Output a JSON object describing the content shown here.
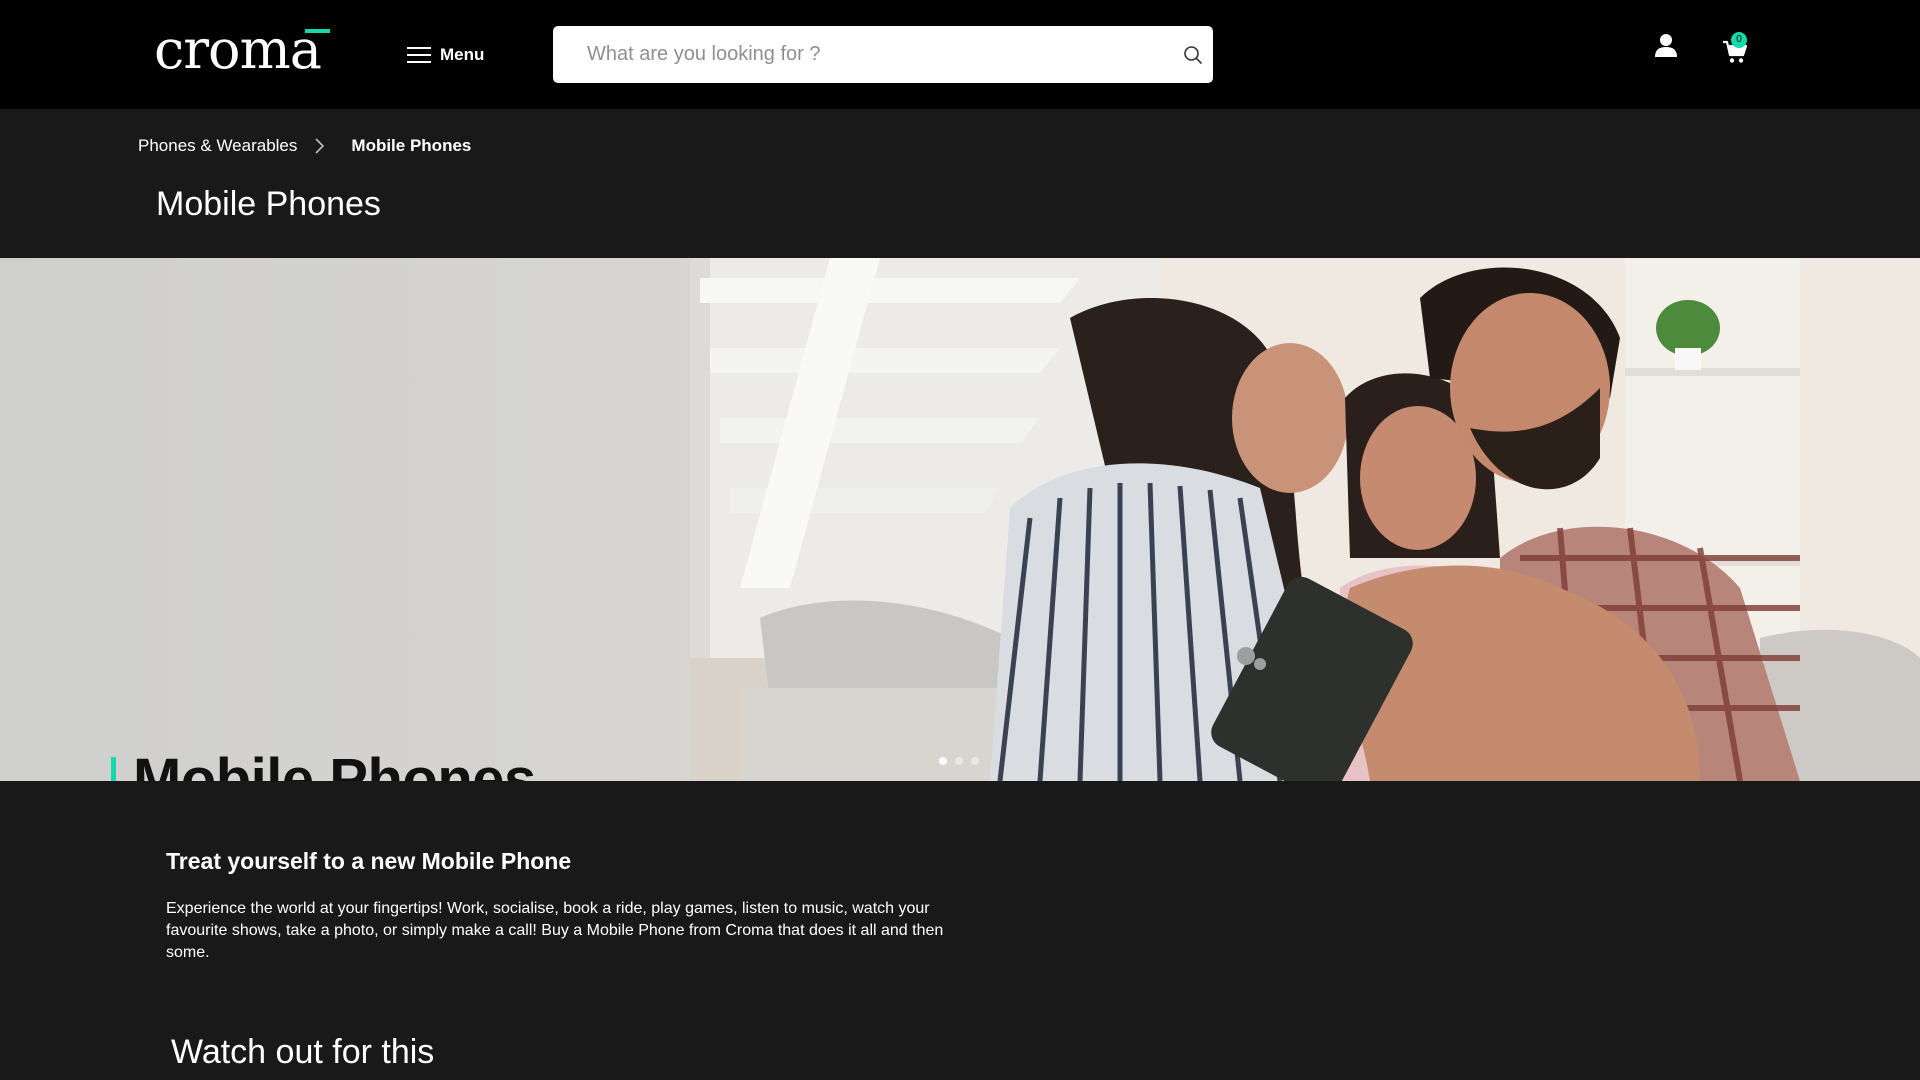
{
  "header": {
    "logo_text": "croma",
    "menu_label": "Menu",
    "search_placeholder": "What are you looking for ?",
    "cart_count": "0",
    "icons": [
      "menu-icon",
      "search-icon",
      "user-icon",
      "cart-icon"
    ]
  },
  "breadcrumb": {
    "items": [
      "Phones & Wearables"
    ],
    "current": "Mobile Phones"
  },
  "page_title": "Mobile Phones",
  "banner": {
    "heading": "Mobile Phones",
    "slides_total": 3,
    "active_slide": 1
  },
  "intro": {
    "heading": "Treat yourself to a new Mobile Phone",
    "text": "Experience the world at your fingertips! Work, socialise, book a ride, play games, listen to music, watch your favourite shows, take a photo, or simply make a call! Buy a Mobile Phone from Croma that does it all and then some."
  },
  "watch_heading": "Watch out for this",
  "colors": {
    "accent": "#12daa8",
    "header_bg": "#000000",
    "page_bg": "#191919"
  }
}
